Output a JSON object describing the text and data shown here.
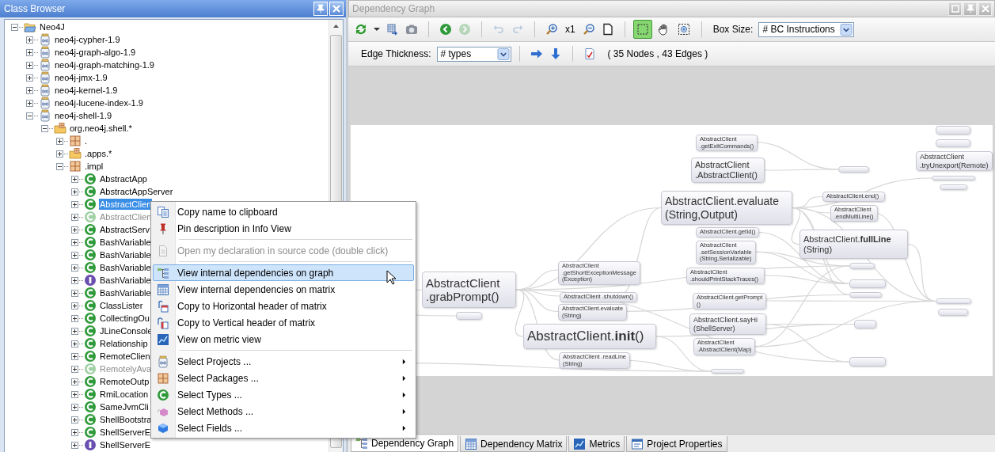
{
  "class_browser": {
    "title": "Class Browser",
    "tree": [
      {
        "label": "Neo4J",
        "kind": "root",
        "expanded": true,
        "selected": false,
        "disabled": false,
        "children": [
          {
            "label": "neo4j-cypher-1.9",
            "kind": "project",
            "expanded": false,
            "selected": false,
            "disabled": false
          },
          {
            "label": "neo4j-graph-algo-1.9",
            "kind": "project",
            "expanded": false,
            "selected": false,
            "disabled": false
          },
          {
            "label": "neo4j-graph-matching-1.9",
            "kind": "project",
            "expanded": false,
            "selected": false,
            "disabled": false
          },
          {
            "label": "neo4j-jmx-1.9",
            "kind": "project",
            "expanded": false,
            "selected": false,
            "disabled": false
          },
          {
            "label": "neo4j-kernel-1.9",
            "kind": "project",
            "expanded": false,
            "selected": false,
            "disabled": false
          },
          {
            "label": "neo4j-lucene-index-1.9",
            "kind": "project",
            "expanded": false,
            "selected": false,
            "disabled": false
          },
          {
            "label": "neo4j-shell-1.9",
            "kind": "project",
            "expanded": true,
            "selected": false,
            "disabled": false,
            "children": [
              {
                "label": "org.neo4j.shell.*",
                "kind": "package-group",
                "expanded": true,
                "selected": false,
                "disabled": false,
                "children": [
                  {
                    "label": ".",
                    "kind": "package",
                    "expanded": false,
                    "selected": false,
                    "disabled": false
                  },
                  {
                    "label": ".apps.*",
                    "kind": "package-group",
                    "expanded": false,
                    "selected": false,
                    "disabled": false
                  },
                  {
                    "label": ".impl",
                    "kind": "package",
                    "expanded": true,
                    "selected": false,
                    "disabled": false,
                    "children": [
                      {
                        "label": "AbstractApp",
                        "kind": "class",
                        "expanded": false,
                        "selected": false,
                        "disabled": false
                      },
                      {
                        "label": "AbstractAppServer",
                        "kind": "class",
                        "expanded": false,
                        "selected": false,
                        "disabled": false
                      },
                      {
                        "label": "AbstractClien",
                        "kind": "class",
                        "expanded": false,
                        "selected": true,
                        "disabled": false
                      },
                      {
                        "label": "AbstractClien",
                        "kind": "class",
                        "expanded": false,
                        "selected": false,
                        "disabled": true
                      },
                      {
                        "label": "AbstractServ",
                        "kind": "class",
                        "expanded": false,
                        "selected": false,
                        "disabled": false
                      },
                      {
                        "label": "BashVariable",
                        "kind": "class",
                        "expanded": false,
                        "selected": false,
                        "disabled": false
                      },
                      {
                        "label": "BashVariable",
                        "kind": "class",
                        "expanded": false,
                        "selected": false,
                        "disabled": false
                      },
                      {
                        "label": "BashVariable",
                        "kind": "class",
                        "expanded": false,
                        "selected": false,
                        "disabled": false
                      },
                      {
                        "label": "BashVariable",
                        "kind": "interface",
                        "expanded": false,
                        "selected": false,
                        "disabled": false
                      },
                      {
                        "label": "BashVariable",
                        "kind": "class",
                        "expanded": false,
                        "selected": false,
                        "disabled": false
                      },
                      {
                        "label": "ClassLister",
                        "kind": "class",
                        "expanded": false,
                        "selected": false,
                        "disabled": false
                      },
                      {
                        "label": "CollectingOu",
                        "kind": "class",
                        "expanded": false,
                        "selected": false,
                        "disabled": false
                      },
                      {
                        "label": "JLineConsole",
                        "kind": "class",
                        "expanded": false,
                        "selected": false,
                        "disabled": false
                      },
                      {
                        "label": "Relationship",
                        "kind": "class",
                        "expanded": false,
                        "selected": false,
                        "disabled": false
                      },
                      {
                        "label": "RemoteClien",
                        "kind": "class",
                        "expanded": false,
                        "selected": false,
                        "disabled": false
                      },
                      {
                        "label": "RemotelyAva",
                        "kind": "class",
                        "expanded": false,
                        "selected": false,
                        "disabled": true
                      },
                      {
                        "label": "RemoteOutp",
                        "kind": "class",
                        "expanded": false,
                        "selected": false,
                        "disabled": false
                      },
                      {
                        "label": "RmiLocation",
                        "kind": "class",
                        "expanded": false,
                        "selected": false,
                        "disabled": false
                      },
                      {
                        "label": "SameJvmCli",
                        "kind": "class",
                        "expanded": false,
                        "selected": false,
                        "disabled": false
                      },
                      {
                        "label": "ShellBootstra",
                        "kind": "class",
                        "expanded": false,
                        "selected": false,
                        "disabled": false
                      },
                      {
                        "label": "ShellServerE",
                        "kind": "class",
                        "expanded": false,
                        "selected": false,
                        "disabled": false
                      },
                      {
                        "label": "ShellServerE",
                        "kind": "interface",
                        "expanded": false,
                        "selected": false,
                        "disabled": false
                      }
                    ]
                  }
                ]
              }
            ]
          }
        ]
      }
    ]
  },
  "context_menu": {
    "items": [
      {
        "kind": "copy",
        "label": "Copy name to clipboard",
        "disabled": false,
        "selected": false,
        "submenu": false
      },
      {
        "kind": "pin",
        "label": "Pin description in Info View",
        "disabled": false,
        "selected": false,
        "submenu": false
      },
      {
        "kind": "separator"
      },
      {
        "kind": "document",
        "label": "Open my declaration in source code (double click)",
        "disabled": true,
        "selected": false,
        "submenu": false
      },
      {
        "kind": "separator"
      },
      {
        "kind": "graph",
        "label": "View internal dependencies on graph",
        "disabled": false,
        "selected": true,
        "submenu": false
      },
      {
        "kind": "matrix",
        "label": "View internal dependencies on matrix",
        "disabled": false,
        "selected": false,
        "submenu": false
      },
      {
        "kind": "hheader",
        "label": "Copy to Horizontal header of matrix",
        "disabled": false,
        "selected": false,
        "submenu": false
      },
      {
        "kind": "vheader",
        "label": "Copy to Vertical header of matrix",
        "disabled": false,
        "selected": false,
        "submenu": false
      },
      {
        "kind": "metric",
        "label": "View on metric view",
        "disabled": false,
        "selected": false,
        "submenu": false
      },
      {
        "kind": "separator"
      },
      {
        "kind": "project",
        "label": "Select Projects ...",
        "disabled": false,
        "selected": false,
        "submenu": true
      },
      {
        "kind": "package",
        "label": "Select Packages ...",
        "disabled": false,
        "selected": false,
        "submenu": true
      },
      {
        "kind": "class",
        "label": "Select Types ...",
        "disabled": false,
        "selected": false,
        "submenu": true
      },
      {
        "kind": "method",
        "label": "Select Methods ...",
        "disabled": false,
        "selected": false,
        "submenu": true
      },
      {
        "kind": "field",
        "label": "Select Fields ...",
        "disabled": false,
        "selected": false,
        "submenu": true
      }
    ]
  },
  "dependency_graph": {
    "title": "Dependency Graph",
    "toolbars": [
      {
        "items": [
          {
            "kind": "refresh",
            "disabled": false
          },
          {
            "kind": "caret",
            "disabled": false
          },
          {
            "kind": "export",
            "disabled": false
          },
          {
            "kind": "camera",
            "disabled": false
          },
          {
            "kind": "separator"
          },
          {
            "kind": "back",
            "disabled": false
          },
          {
            "kind": "forward",
            "disabled": true
          },
          {
            "kind": "separator"
          },
          {
            "kind": "undo",
            "disabled": true
          },
          {
            "kind": "redo",
            "disabled": true
          },
          {
            "kind": "separator"
          },
          {
            "kind": "zoom-in",
            "disabled": false
          },
          {
            "kind": "text",
            "text": "x1"
          },
          {
            "kind": "zoom-out",
            "disabled": false
          },
          {
            "kind": "page",
            "disabled": false
          },
          {
            "kind": "separator"
          },
          {
            "kind": "marquee",
            "selected": true
          },
          {
            "kind": "pan",
            "selected": false
          },
          {
            "kind": "zoom-area",
            "selected": false
          },
          {
            "kind": "separator"
          },
          {
            "kind": "select",
            "label": "Box Size:",
            "value": "# BC Instructions"
          }
        ]
      },
      {
        "items": [
          {
            "kind": "select",
            "label": "Edge Thickness:",
            "value": "# types"
          },
          {
            "kind": "separator"
          },
          {
            "kind": "arrow-right",
            "disabled": false
          },
          {
            "kind": "arrow-down",
            "disabled": false
          },
          {
            "kind": "separator"
          },
          {
            "kind": "report",
            "disabled": false
          },
          {
            "kind": "text",
            "text": "( 35 Nodes , 43 Edges )"
          }
        ]
      }
    ],
    "nodes": [
      {
        "kind": "method",
        "lines": [
          "AbstractClient",
          ".grabPrompt()"
        ]
      },
      {
        "kind": "method",
        "lines": [
          "AbstractClient",
          ".getShortExceptionMessage",
          "(Exception)"
        ]
      },
      {
        "kind": "method",
        "lines": [
          "AbstractClient .shutdown()"
        ]
      },
      {
        "kind": "method",
        "lines": [
          "AbstractClient.evaluate",
          "(String)"
        ]
      },
      {
        "kind": "method",
        "lines": [
          "AbstractClient.**init**()"
        ]
      },
      {
        "kind": "method",
        "lines": [
          "AbstractClient .readLine",
          "(String)"
        ]
      },
      {
        "kind": "blank"
      },
      {
        "kind": "method",
        "lines": [
          "AbstractClient",
          ".getExitCommands()"
        ]
      },
      {
        "kind": "method",
        "lines": [
          "AbstractClient",
          ".AbstractClient()"
        ]
      },
      {
        "kind": "blank"
      },
      {
        "kind": "blank"
      },
      {
        "kind": "blank"
      },
      {
        "kind": "method",
        "lines": [
          "AbstractClient",
          ".tryUnexport(Remote)"
        ]
      },
      {
        "kind": "blank"
      },
      {
        "kind": "blank"
      },
      {
        "kind": "method",
        "lines": [
          "AbstractClient.evaluate",
          "(String,Output)"
        ]
      },
      {
        "kind": "method",
        "lines": [
          "AbstractClient.end()"
        ]
      },
      {
        "kind": "method",
        "lines": [
          "AbstractClient",
          ".endMultiLine()"
        ]
      },
      {
        "kind": "method",
        "lines": [
          "AbstractClient.getId()"
        ]
      },
      {
        "kind": "method",
        "lines": [
          "AbstractClient",
          ".setSessionVariable",
          "(String,Serializable)"
        ]
      },
      {
        "kind": "method",
        "lines": [
          "AbstractClient.**fullLine**",
          "(String)"
        ]
      },
      {
        "kind": "method",
        "lines": [
          "AbstractClient",
          ".shouldPrintStackTraces()"
        ]
      },
      {
        "kind": "blank"
      },
      {
        "kind": "blank"
      },
      {
        "kind": "blank"
      },
      {
        "kind": "method",
        "lines": [
          "AbstractClient.getPrompt",
          "()"
        ]
      },
      {
        "kind": "blank"
      },
      {
        "kind": "blank"
      },
      {
        "kind": "method",
        "lines": [
          "AbstractClient.sayHi",
          "(ShellServer)"
        ]
      },
      {
        "kind": "blank"
      },
      {
        "kind": "method",
        "lines": [
          "AbstractClient",
          ".AbstractClient(Map)"
        ]
      },
      {
        "kind": "blank"
      },
      {
        "kind": "blank"
      }
    ],
    "tabs": [
      {
        "label": "Dependency Graph",
        "kind": "graph",
        "selected": true
      },
      {
        "label": "Dependency Matrix",
        "kind": "matrix",
        "selected": false
      },
      {
        "label": "Metrics",
        "kind": "metric",
        "selected": false
      },
      {
        "label": "Project Properties",
        "kind": "properties",
        "selected": false
      }
    ]
  }
}
